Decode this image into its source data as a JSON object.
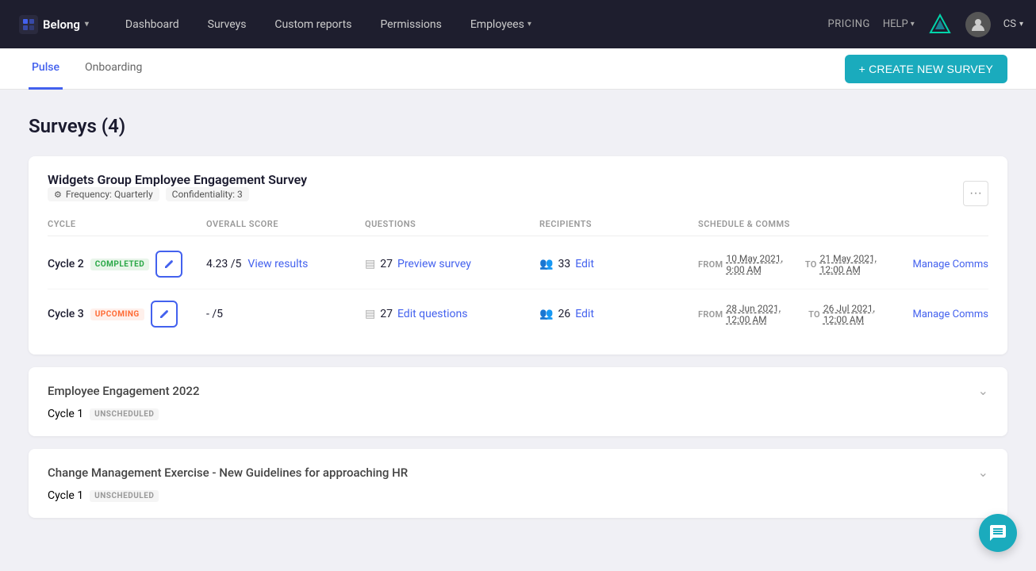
{
  "navbar": {
    "brand": "Belong",
    "brand_chevron": "▾",
    "links": [
      {
        "id": "dashboard",
        "label": "Dashboard"
      },
      {
        "id": "surveys",
        "label": "Surveys"
      },
      {
        "id": "custom-reports",
        "label": "Custom reports"
      },
      {
        "id": "permissions",
        "label": "Permissions"
      },
      {
        "id": "employees",
        "label": "Employees",
        "has_chevron": true
      }
    ],
    "pricing": "PRICING",
    "help": "HELP",
    "help_chevron": "▾",
    "user_initials": "CS",
    "user_chevron": "▾"
  },
  "subtabs": [
    {
      "id": "pulse",
      "label": "Pulse",
      "active": true
    },
    {
      "id": "onboarding",
      "label": "Onboarding"
    }
  ],
  "create_btn_label": "+ CREATE NEW SURVEY",
  "page_title": "Surveys (4)",
  "surveys": [
    {
      "id": "survey-1",
      "name": "Widgets Group Employee Engagement Survey",
      "meta": [
        {
          "icon": "⚙",
          "text": "Frequency: Quarterly"
        },
        {
          "text": "Confidentiality: 3"
        }
      ],
      "columns": [
        "CYCLE",
        "OVERALL SCORE",
        "QUESTIONS",
        "RECIPIENTS",
        "SCHEDULE & COMMS"
      ],
      "cycles": [
        {
          "cycle": "Cycle 2",
          "status": "COMPLETED",
          "status_type": "completed",
          "score": "4.23 /5",
          "score_link": "View results",
          "questions_count": "27",
          "questions_link": "Preview survey",
          "recipients_count": "33",
          "recipients_link": "Edit",
          "from_label": "FROM",
          "from_date": "10 May 2021, 9:00 AM",
          "to_label": "TO",
          "to_date": "21 May 2021, 12:00 AM",
          "manage_link": "Manage Comms"
        },
        {
          "cycle": "Cycle 3",
          "status": "UPCOMING",
          "status_type": "upcoming",
          "score": "- /5",
          "score_link": "",
          "questions_count": "27",
          "questions_link": "Edit questions",
          "recipients_count": "26",
          "recipients_link": "Edit",
          "from_label": "FROM",
          "from_date": "28 Jun 2021, 12:00 AM",
          "to_label": "TO",
          "to_date": "26 Jul 2021, 12:00 AM",
          "manage_link": "Manage Comms"
        }
      ]
    }
  ],
  "collapsed_surveys": [
    {
      "id": "survey-2",
      "name": "Employee Engagement 2022",
      "cycles": [
        {
          "cycle": "Cycle 1",
          "status": "UNSCHEDULED",
          "status_type": "unscheduled"
        }
      ]
    },
    {
      "id": "survey-3",
      "name": "Change Management Exercise - New Guidelines for approaching HR",
      "cycles": [
        {
          "cycle": "Cycle 1",
          "status": "UNSCHEDULED",
          "status_type": "unscheduled"
        }
      ]
    }
  ]
}
